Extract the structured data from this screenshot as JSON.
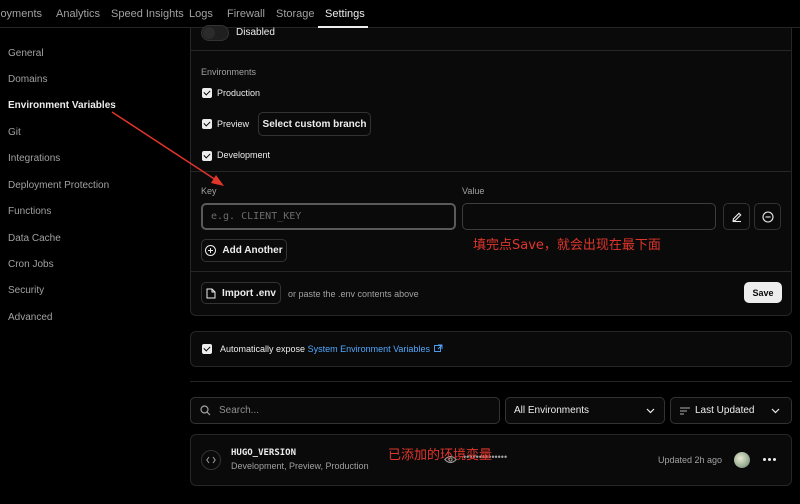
{
  "topnav": {
    "tabs": [
      "loyments",
      "Analytics",
      "Speed Insights",
      "Logs",
      "Firewall",
      "Storage",
      "Settings"
    ],
    "active": "Settings"
  },
  "sidebar": {
    "items": [
      "General",
      "Domains",
      "Environment Variables",
      "Git",
      "Integrations",
      "Deployment Protection",
      "Functions",
      "Data Cache",
      "Cron Jobs",
      "Security",
      "Advanced"
    ],
    "active": "Environment Variables"
  },
  "form": {
    "toggle_label": "Disabled",
    "environments_label": "Environments",
    "env_production": "Production",
    "env_preview": "Preview",
    "select_branch": "Select custom branch",
    "env_development": "Development",
    "key_label": "Key",
    "key_placeholder": "e.g. CLIENT_KEY",
    "value_label": "Value",
    "value_value": "",
    "add_another": "Add Another",
    "import_env": "Import .env",
    "paste_hint": "or paste the .env contents above",
    "save": "Save"
  },
  "annotations": {
    "save_note": "填完点Save，就会出现在最下面",
    "added_note": "已添加的环境变量",
    "color": "#e0352b"
  },
  "expose": {
    "prefix": "Automatically expose",
    "link": "System Environment Variables"
  },
  "list": {
    "search_placeholder": "Search...",
    "env_filter": "All Environments",
    "sort": "Last Updated",
    "rows": [
      {
        "name": "HUGO_VERSION",
        "environments": "Development, Preview, Production",
        "value_masked": "••••••••••••••",
        "updated": "Updated 2h ago"
      }
    ]
  },
  "colors": {
    "background": "#000000",
    "card": "#0a0a0a",
    "border": "#262626",
    "link": "#52a8ff"
  }
}
